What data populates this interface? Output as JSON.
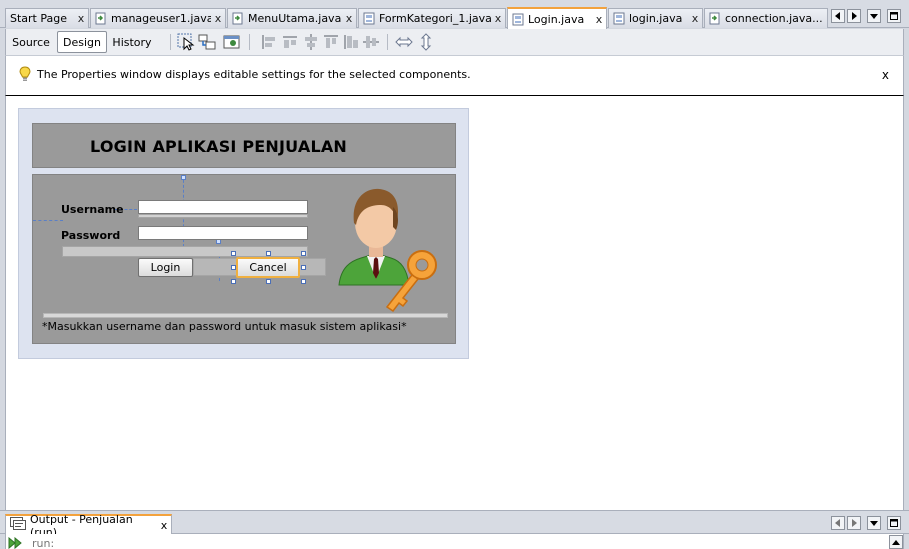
{
  "editor_tabs": [
    {
      "label": "Start Page",
      "icon": "none",
      "active": false
    },
    {
      "label": "manageuser1.java",
      "icon": "java-class-icon",
      "active": false
    },
    {
      "label": "MenuUtama.java",
      "icon": "java-class-icon",
      "active": false
    },
    {
      "label": "FormKategori_1.java",
      "icon": "java-form-icon",
      "active": false
    },
    {
      "label": "Login.java",
      "icon": "java-form-icon",
      "active": true
    },
    {
      "label": "login.java",
      "icon": "java-form-icon",
      "active": false
    },
    {
      "label": "connection.java...",
      "icon": "java-class-icon",
      "active": false
    }
  ],
  "tab_close_glyph": "x",
  "toolbar": {
    "source_label": "Source",
    "design_label": "Design",
    "history_label": "History",
    "selected_view": "Design",
    "icons": [
      "selection-mode-icon",
      "connection-mode-icon",
      "preview-design-icon",
      "align-left-icon",
      "align-right-icon",
      "center-horizontal-icon",
      "align-top-icon",
      "align-bottom-icon",
      "center-vertical-icon",
      "resize-horizontal-icon",
      "resize-vertical-icon"
    ]
  },
  "infobar": {
    "message": "The Properties window displays editable settings for the selected components.",
    "close_label": "x",
    "icon": "lightbulb-icon"
  },
  "form": {
    "title": "LOGIN APLIKASI PENJUALAN",
    "username_label": "Username",
    "password_label": "Password",
    "login_button": "Login",
    "cancel_button": "Cancel",
    "footnote": "*Masukkan username dan password untuk masuk sistem aplikasi*",
    "image": "user-with-key-icon",
    "selected_component": "Cancel"
  },
  "output": {
    "tab_label": "Output - Penjualan (run)",
    "close_label": "x",
    "first_line": "run:",
    "icon": "output-window-icon"
  },
  "colors": {
    "active_tab_accent": "#f3a23d",
    "form_panel": "#9a9a9a",
    "form_frame": "#dde3f0",
    "selection_border": "#f0b040"
  }
}
